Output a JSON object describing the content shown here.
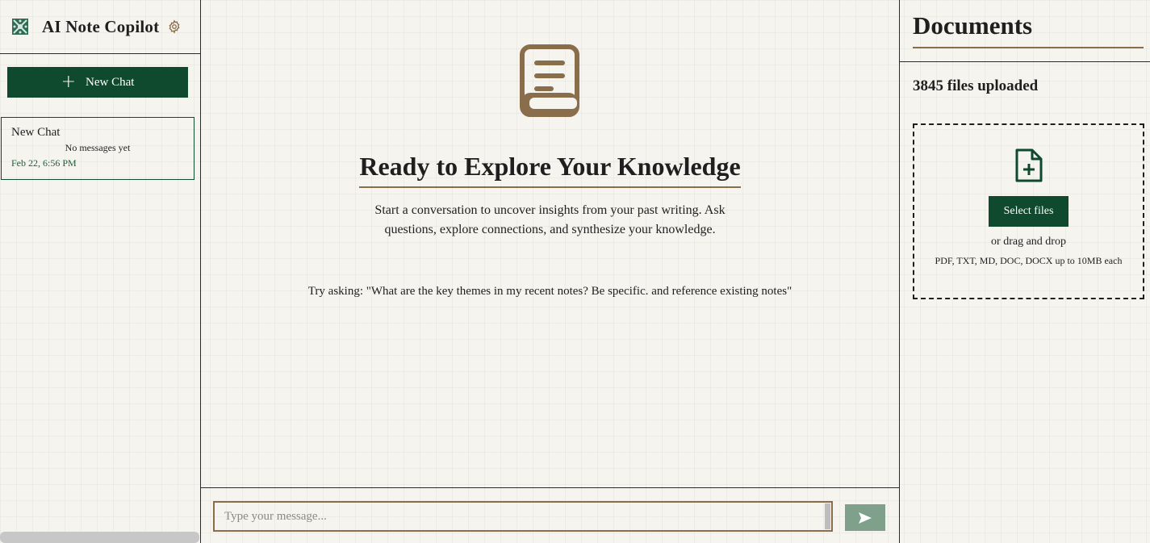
{
  "app": {
    "title": "AI Note Copilot"
  },
  "sidebar": {
    "new_chat_label": "New Chat",
    "chats": [
      {
        "title": "New Chat",
        "preview": "No messages yet",
        "date": "Feb 22, 6:56 PM"
      }
    ]
  },
  "main": {
    "title": "Ready to Explore Your Knowledge",
    "subtitle": "Start a conversation to uncover insights from your past writing. Ask questions, explore connections, and synthesize your knowledge.",
    "try_asking": "Try asking: \"What are the key themes in my recent notes? Be specific. and reference existing notes\"",
    "input_placeholder": "Type your message..."
  },
  "documents": {
    "title": "Documents",
    "files_count": "3845 files uploaded",
    "select_label": "Select files",
    "or_text": "or drag and drop",
    "hint": "PDF, TXT, MD, DOC, DOCX up to 10MB each"
  },
  "colors": {
    "primary": "#0f4a2e",
    "accent": "#8a6e4b",
    "send_disabled": "#7fa08a",
    "background": "#f6f4ee"
  },
  "icons": [
    "logo-icon",
    "gear-icon",
    "plus-icon",
    "book-icon",
    "send-icon",
    "file-plus-icon"
  ]
}
